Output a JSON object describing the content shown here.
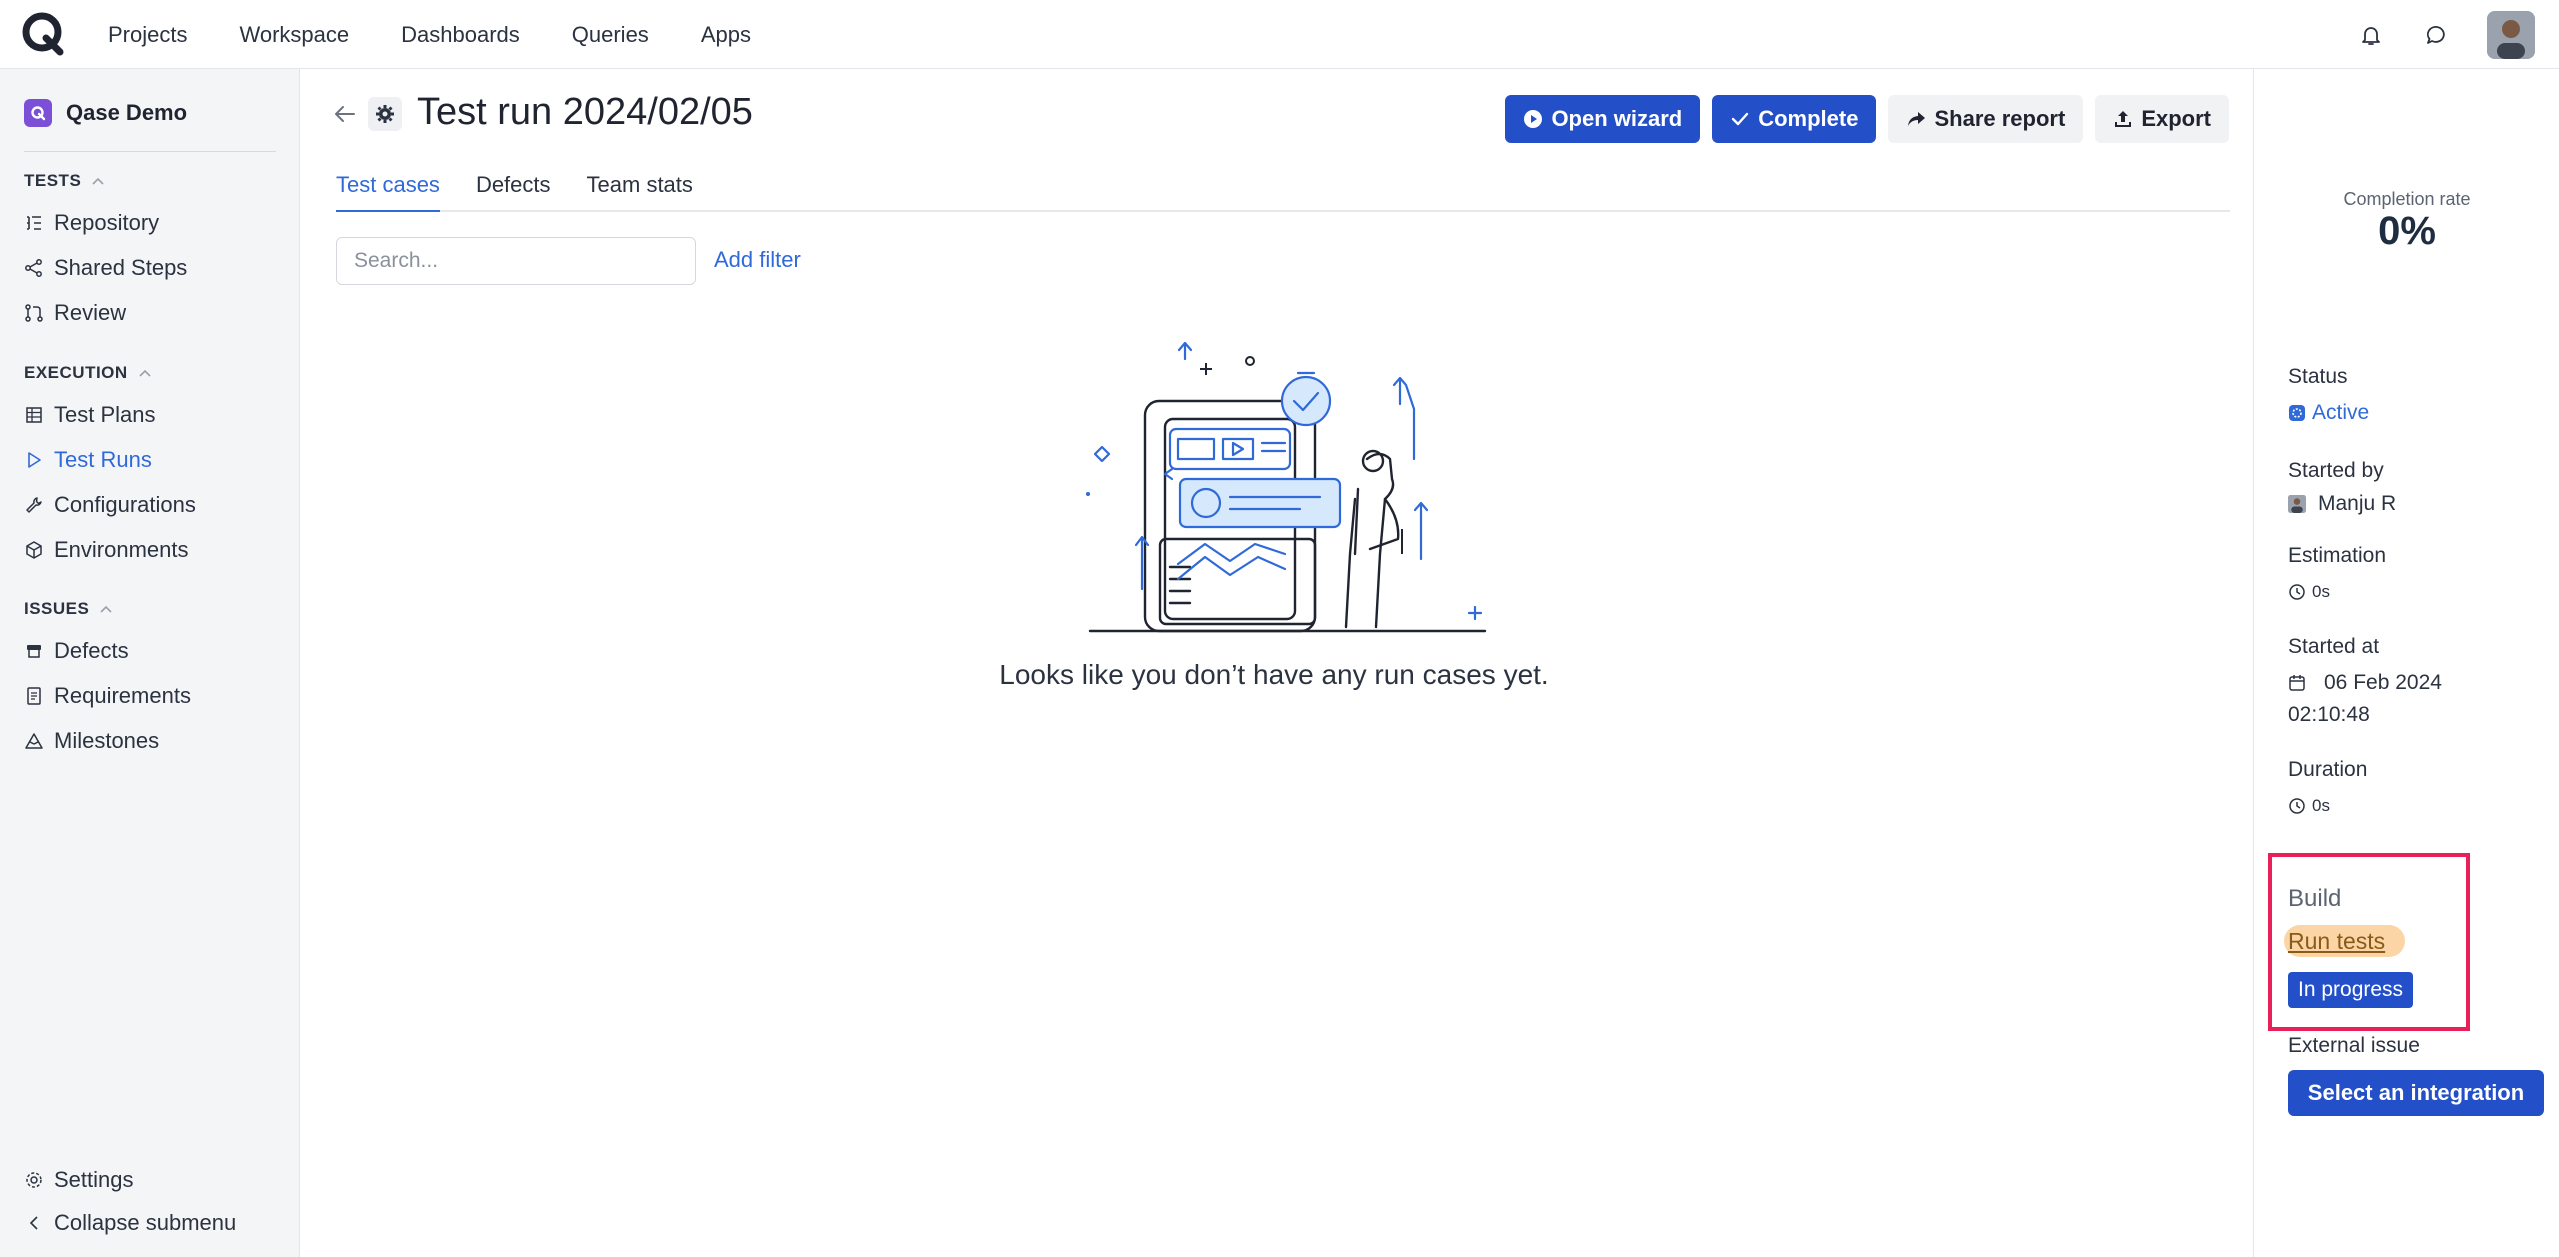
{
  "topnav": {
    "items": [
      "Projects",
      "Workspace",
      "Dashboards",
      "Queries",
      "Apps"
    ],
    "icons": [
      "bell-icon",
      "chat-icon"
    ]
  },
  "sidebar": {
    "project": "Qase Demo",
    "sections": {
      "tests": "TESTS",
      "execution": "EXECUTION",
      "issues": "ISSUES"
    },
    "items": {
      "repository": "Repository",
      "shared_steps": "Shared Steps",
      "review": "Review",
      "test_plans": "Test Plans",
      "test_runs": "Test Runs",
      "configurations": "Configurations",
      "environments": "Environments",
      "defects": "Defects",
      "requirements": "Requirements",
      "milestones": "Milestones",
      "settings": "Settings",
      "collapse": "Collapse submenu"
    },
    "active_item": "Test Runs"
  },
  "main": {
    "title": "Test run 2024/02/05",
    "buttons": {
      "open_wizard": "Open wizard",
      "complete": "Complete",
      "share_report": "Share report",
      "export": "Export"
    },
    "tabs": [
      "Test cases",
      "Defects",
      "Team stats"
    ],
    "active_tab": "Test cases",
    "search_placeholder": "Search...",
    "add_filter": "Add filter",
    "empty_message": "Looks like you don’t have any run cases yet."
  },
  "panel": {
    "completion_label": "Completion rate",
    "completion_value": "0%",
    "status_label": "Status",
    "status_value": "Active",
    "started_by_label": "Started by",
    "started_by_value": "Manju R",
    "estimation_label": "Estimation",
    "estimation_value": "0s",
    "started_at_label": "Started at",
    "started_at_date": "06 Feb 2024",
    "started_at_time": "02:10:48",
    "duration_label": "Duration",
    "duration_value": "0s",
    "build_label": "Build",
    "build_link": "Run tests",
    "build_status": "In progress",
    "external_issue_label": "External issue",
    "select_integration": "Select an integration"
  },
  "colors": {
    "accent": "#2f6ad8",
    "primary_button": "#2350c8",
    "highlight_border": "#e8205a",
    "build_tag": "#fbd5a6"
  }
}
